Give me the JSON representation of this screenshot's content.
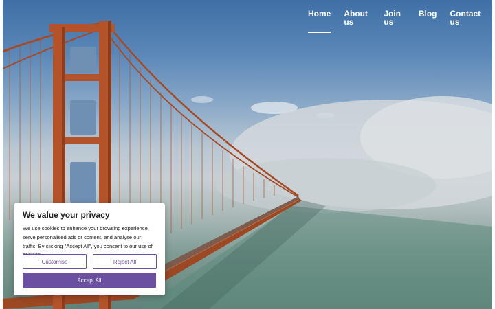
{
  "nav": {
    "items": [
      {
        "label": "Home",
        "active": true
      },
      {
        "label": "About us",
        "active": false
      },
      {
        "label": "Join us",
        "active": false
      },
      {
        "label": "Blog",
        "active": false
      },
      {
        "label": "Contact us",
        "active": false
      }
    ]
  },
  "cookie_banner": {
    "title": "We value your privacy",
    "body": "We use cookies to enhance your browsing experience, serve personalised ads or content, and analyse our traffic. By clicking \"Accept All\", you consent to our use of cookies.",
    "customise_label": "Customise",
    "reject_label": "Reject All",
    "accept_label": "Accept All"
  },
  "colors": {
    "accent": "#6b4fa0",
    "nav_text": "#ffffff",
    "bridge": "#b4532a"
  }
}
